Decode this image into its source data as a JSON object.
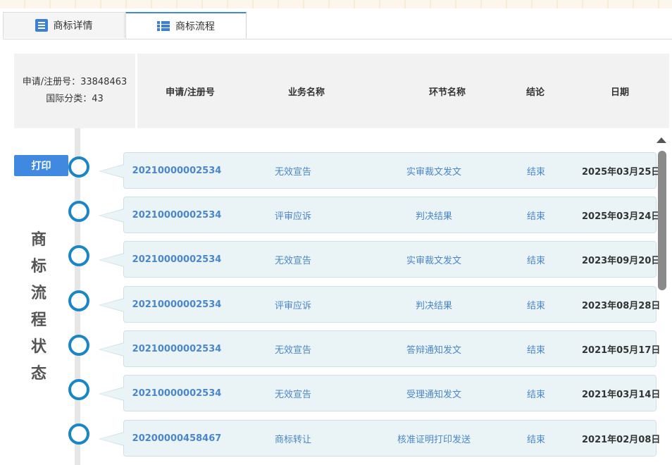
{
  "tabs": [
    {
      "label": "商标详情",
      "icon": "document-icon"
    },
    {
      "label": "商标流程",
      "icon": "list-icon"
    }
  ],
  "info": {
    "reg_no": "申请/注册号：33848463",
    "intl_class": "国际分类：43"
  },
  "columns": {
    "reg_no": "申请/注册号",
    "business": "业务名称",
    "step": "环节名称",
    "result": "结论",
    "date": "日期"
  },
  "print_label": "打印",
  "side_label": [
    "商",
    "标",
    "流",
    "程",
    "状",
    "态"
  ],
  "colors": {
    "accent": "#3f8ae0",
    "node": "#1a86c6",
    "link": "#4a86c9",
    "card": "#eaf4f7"
  },
  "rows": [
    {
      "reg_no": "20210000002534",
      "business": "无效宣告",
      "step": "实审裁文发文",
      "result": "结束",
      "date": "2025年03月25日"
    },
    {
      "reg_no": "20210000002534",
      "business": "评审应诉",
      "step": "判决结果",
      "result": "结束",
      "date": "2025年03月24日"
    },
    {
      "reg_no": "20210000002534",
      "business": "无效宣告",
      "step": "实审裁文发文",
      "result": "结束",
      "date": "2023年09月20日"
    },
    {
      "reg_no": "20210000002534",
      "business": "评审应诉",
      "step": "判决结果",
      "result": "结束",
      "date": "2023年08月28日"
    },
    {
      "reg_no": "20210000002534",
      "business": "无效宣告",
      "step": "答辩通知发文",
      "result": "结束",
      "date": "2021年05月17日"
    },
    {
      "reg_no": "20210000002534",
      "business": "无效宣告",
      "step": "受理通知发文",
      "result": "结束",
      "date": "2021年03月14日"
    },
    {
      "reg_no": "20200000458467",
      "business": "商标转让",
      "step": "核准证明打印发送",
      "result": "结束",
      "date": "2021年02月08日"
    }
  ]
}
